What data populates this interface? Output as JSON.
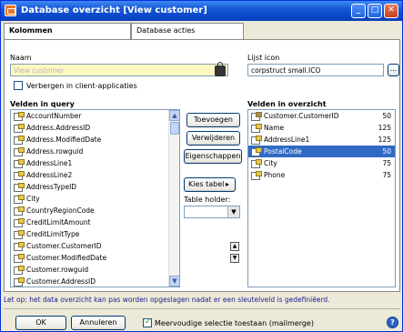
{
  "window": {
    "title": "Database overzicht [View customer]"
  },
  "tabs": [
    {
      "label": "Kolommen"
    },
    {
      "label": "Database acties"
    }
  ],
  "form": {
    "name_label": "Naam",
    "name_value": "View customer",
    "icon_list_label": "Lijst icon",
    "icon_value": "corpstruct small.ICO",
    "browse_label": "...",
    "hide_label": "Verbergen in client-applicaties"
  },
  "left_list": {
    "header": "Velden in query",
    "items": [
      "AccountNumber",
      "Address.AddressID",
      "Address.ModifiedDate",
      "Address.rowguid",
      "AddressLine1",
      "AddressLine2",
      "AddressTypeID",
      "City",
      "CountryRegionCode",
      "CreditLimitAmount",
      "CreditLimitType",
      "Customer.CustomerID",
      "Customer.ModifiedDate",
      "Customer.rowguid",
      "Customer.AddressID"
    ]
  },
  "middle": {
    "add": "Toevoegen",
    "remove": "Verwijderen",
    "properties": "Eigenschappen",
    "choose_table": "Kies tabel",
    "table_holder": "Table holder:",
    "table_holder_value": ""
  },
  "right_list": {
    "header": "Velden in overzicht",
    "items": [
      {
        "name": "Customer.CustomerID",
        "size": "50"
      },
      {
        "name": "Name",
        "size": "125"
      },
      {
        "name": "AddressLine1",
        "size": "125"
      },
      {
        "name": "PostalCode",
        "size": "50",
        "selected": true
      },
      {
        "name": "City",
        "size": "75"
      },
      {
        "name": "Phone",
        "size": "75"
      }
    ]
  },
  "notice": "Let op: het data overzicht kan pas worden opgeslagen nadat er een sleutelveld is gedefiniëerd.",
  "footer": {
    "ok": "OK",
    "cancel": "Annuleren",
    "multi_select": "Meervoudige selectie toestaan (mailmerge)"
  },
  "colors": {
    "title_bar": "#0a46c9",
    "selection": "#316ac5",
    "name_field": "#fff7c0"
  }
}
